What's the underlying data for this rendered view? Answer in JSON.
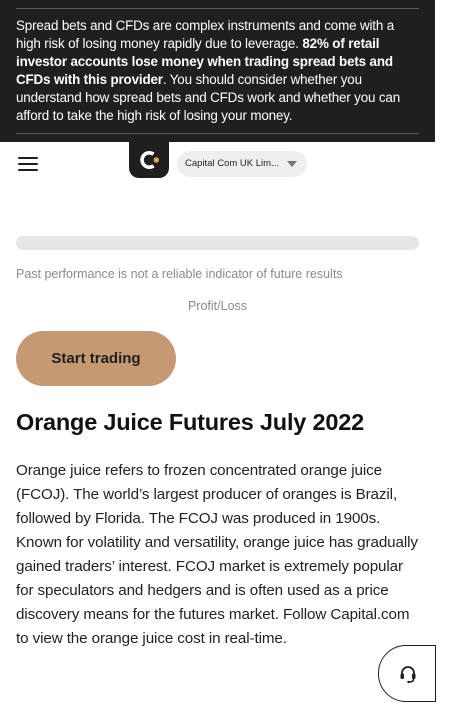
{
  "risk_warning": {
    "text_before": "Spread bets and CFDs are complex instruments and come with a high risk of losing money rapidly due to leverage. ",
    "bold_text": "82% of retail investor accounts lose money when trading spread bets and CFDs with this provider",
    "text_after": ". You should consider whether you understand how spread bets and CFDs work and whether you can afford to take the high risk of losing your money."
  },
  "header": {
    "menu_icon": "hamburger-menu-icon",
    "logo_icon": "capital-com-logo",
    "entity_selector": {
      "label": "Capital Com UK Lim..."
    }
  },
  "chart_area": {
    "disclaimer": "Past performance is not a reliable indicator of future results",
    "label": "Profit/Loss"
  },
  "cta": {
    "label": "Start trading"
  },
  "content": {
    "title": "Orange Juice Futures July 2022",
    "description": "Orange juice refers to frozen concentrated orange juice (FCOJ). The world’s largest producer of oranges is Brazil, followed by Florida. The FCOJ was produced in 1900s. Known for volatility and versatility, orange juice has gradually gained traders’ interest. FCOJ market is extremely popular for speculators and hedgers and is often used as a price discovery means for the futures market. Follow Capital.com to view the orange juice cost in real-time."
  },
  "support": {
    "icon": "headset-icon"
  },
  "colors": {
    "banner_bg": "#1f1f1f",
    "accent": "#c59a73",
    "logo_dot": "#d8a66b",
    "muted_text": "#8a8a8a",
    "skeleton": "#e6e6e6"
  }
}
